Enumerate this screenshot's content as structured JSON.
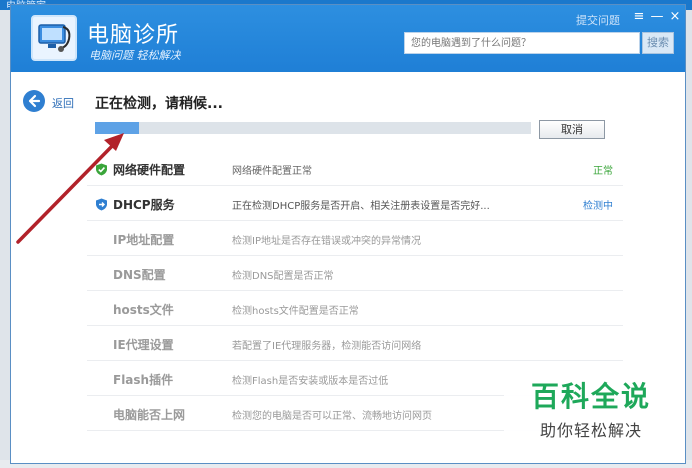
{
  "outer": {
    "title": "电脑管家"
  },
  "header": {
    "app_title": "电脑诊所",
    "app_subtitle": "电脑问题 轻松解决",
    "feedback": "提交问题",
    "search_placeholder": "您的电脑遇到了什么问题？",
    "search_button": "搜索",
    "menu_icon": "≡",
    "minimize_icon": "—",
    "close_icon": "×"
  },
  "nav": {
    "back_label": "返回"
  },
  "scan": {
    "status_title": "正在检测，请稍候...",
    "progress": 0.1,
    "cancel_label": "取消"
  },
  "rows": [
    {
      "name": "网络硬件配置",
      "desc": "网络硬件配置正常",
      "status": "正常",
      "state": "done"
    },
    {
      "name": "DHCP服务",
      "desc": "正在检测DHCP服务是否开启、相关注册表设置是否完好...",
      "status": "检测中",
      "state": "active"
    },
    {
      "name": "IP地址配置",
      "desc": "检测IP地址是否存在错误或冲突的异常情况",
      "status": "",
      "state": "pending"
    },
    {
      "name": "DNS配置",
      "desc": "检测DNS配置是否正常",
      "status": "",
      "state": "pending"
    },
    {
      "name": "hosts文件",
      "desc": "检测hosts文件配置是否正常",
      "status": "",
      "state": "pending"
    },
    {
      "name": "IE代理设置",
      "desc": "若配置了IE代理服务器，检测能否访问网络",
      "status": "",
      "state": "pending"
    },
    {
      "name": "Flash插件",
      "desc": "检测Flash是否安装或版本是否过低",
      "status": "",
      "state": "pending"
    },
    {
      "name": "电脑能否上网",
      "desc": "检测您的电脑是否可以正常、流畅地访问网页",
      "status": "",
      "state": "pending"
    }
  ],
  "watermark": {
    "title": "百科全说",
    "subtitle": "助你轻松解决"
  },
  "colors": {
    "ok_green": "#3aa53a",
    "checking_blue": "#2f7fd1",
    "arrow_red": "#b2222a",
    "header_blue": "#2388db"
  }
}
